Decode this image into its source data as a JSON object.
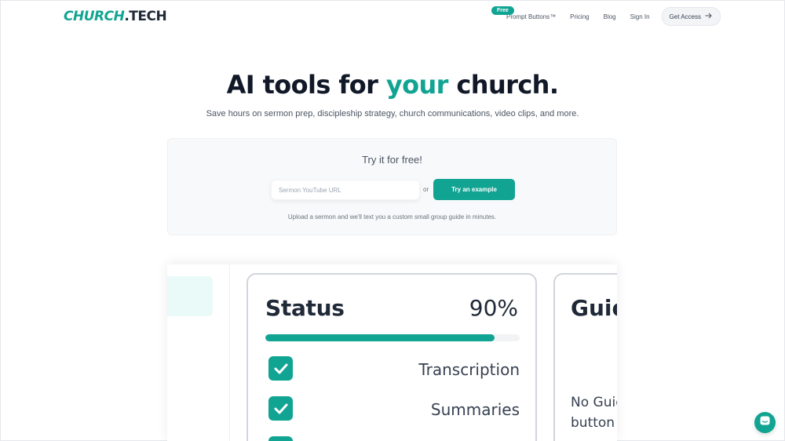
{
  "nav": {
    "logo_part1": "CHURCH",
    "logo_part2": ".TECH",
    "badge": "Free",
    "items": [
      "Prompt Buttons™",
      "Pricing",
      "Blog",
      "Sign In"
    ],
    "cta_label": "Get Access"
  },
  "hero": {
    "title_pre": "AI tools for ",
    "title_accent": "your",
    "title_post": " church.",
    "subtitle": "Save hours on sermon prep, discipleship strategy, church communications, video clips, and more."
  },
  "try_box": {
    "title": "Try it for free!",
    "input_placeholder": "Sermon YouTube URL",
    "or_text": "or",
    "button_label": "Try an example",
    "note": "Upload a sermon and we'll text you a custom small group guide in minutes."
  },
  "preview": {
    "status_label": "Status",
    "status_percent": "90%",
    "progress": 0.9,
    "checks": [
      "Transcription",
      "Summaries"
    ],
    "guide_title": "Guides",
    "guide_text": "No Guides button Guide"
  },
  "colors": {
    "accent": "#12a493",
    "text_dark": "#111827"
  },
  "icons": {
    "cta_arrow": "arrow-right-icon",
    "check": "check-icon",
    "chat": "chat-icon"
  }
}
